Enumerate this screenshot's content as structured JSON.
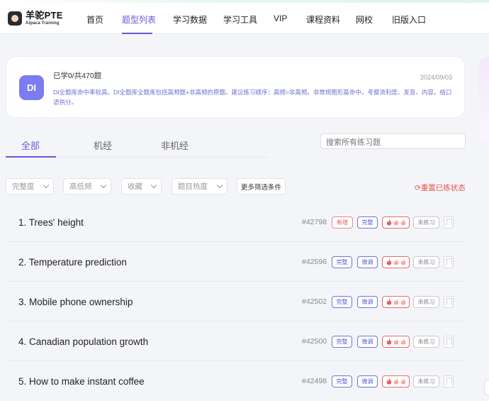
{
  "header": {
    "logo_title": "羊驼PTE",
    "logo_subtitle": "Alpaca Training",
    "nav": [
      "首页",
      "题型列表",
      "学习数据",
      "学习工具",
      "VIP",
      "课程资料",
      "网校",
      "旧版入口"
    ],
    "active_nav": "题型列表"
  },
  "summary": {
    "badge": "DI",
    "learned_prefix": "已学",
    "learned_count": "0",
    "total_text": "/共470题",
    "date": "2024/09/03",
    "description": "DI全题库命中率较高。DI全题库全题库包括高频题+非高频的原题。建议练习顺序：高频>非高频。非常规图形高命中。考察流利度、发音、内容。结口语供分。"
  },
  "tabs": [
    "全部",
    "机经",
    "非机经"
  ],
  "active_tab": "全部",
  "search": {
    "placeholder": "搜索所有练习题"
  },
  "filters": [
    "完整度",
    "高低频",
    "收藏",
    "题目热度"
  ],
  "more_filters": "更多筛选条件",
  "reset_label": "重置已练状态",
  "questions": [
    {
      "title": "1. Trees' height",
      "id": "#42798",
      "tags": [
        "新增",
        "完整"
      ],
      "status": "未练习"
    },
    {
      "title": "2. Temperature prediction",
      "id": "#42596",
      "tags": [
        "完整",
        "微调"
      ],
      "status": "未练习"
    },
    {
      "title": "3. Mobile phone ownership",
      "id": "#42502",
      "tags": [
        "完整",
        "微调"
      ],
      "status": "未练习"
    },
    {
      "title": "4. Canadian population growth",
      "id": "#42500",
      "tags": [
        "完整",
        "微调"
      ],
      "status": "未练习"
    },
    {
      "title": "5. How to make instant coffee",
      "id": "#42498",
      "tags": [
        "完整",
        "微调"
      ],
      "status": "未练习"
    }
  ],
  "colors": {
    "accent": "#6f55d8",
    "badge_bg": "#7b7cf0",
    "danger": "#e5564a",
    "tag_blue": "#555bcc"
  }
}
